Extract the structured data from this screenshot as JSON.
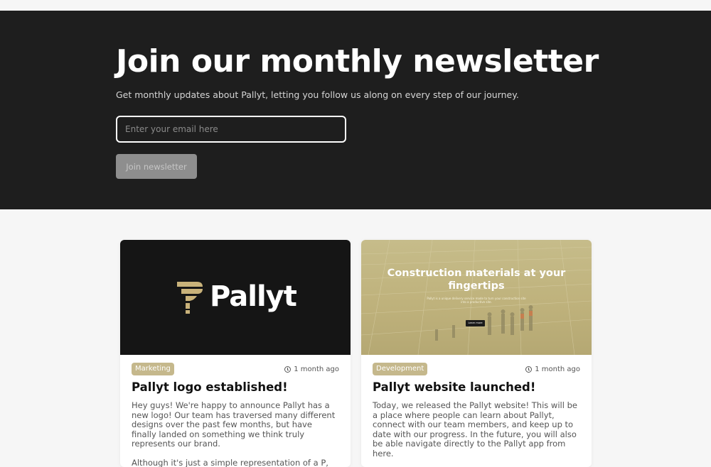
{
  "newsletter": {
    "title": "Join our monthly newsletter",
    "subtitle": "Get monthly updates about Pallyt, letting you follow us along on every step of our journey.",
    "email_placeholder": "Enter your email here",
    "button_label": "Join newsletter"
  },
  "posts": [
    {
      "image": {
        "logo_text": "Pallyt"
      },
      "tag": "Marketing",
      "date": "1 month ago",
      "title": "Pallyt logo established!",
      "paragraphs": [
        "Hey guys! We're happy to announce Pallyt has a new logo! Our team has traversed many different designs over the past few months, but have finally landed on something we think truly represents our brand.",
        "Although it's just a simple representation of a P, our"
      ]
    },
    {
      "image": {
        "headline": "Construction materials at your fingertips",
        "small_text": "Pallyt is a unique delivery service made to turn your construction site into a productive site.",
        "button_label": "Learn more"
      },
      "tag": "Development",
      "date": "1 month ago",
      "title": "Pallyt website launched!",
      "paragraphs": [
        "Today, we released the Pallyt website! This will be a place where people can learn about Pallyt, connect with our team members, and keep up to date with our progress. In the future, you will also be able navigate directly to the Pallyt app from here."
      ]
    }
  ],
  "colors": {
    "dark_bg": "#1e1e1e",
    "tag_bg": "#c5b88c",
    "brand_gold": "#c9b27a"
  }
}
